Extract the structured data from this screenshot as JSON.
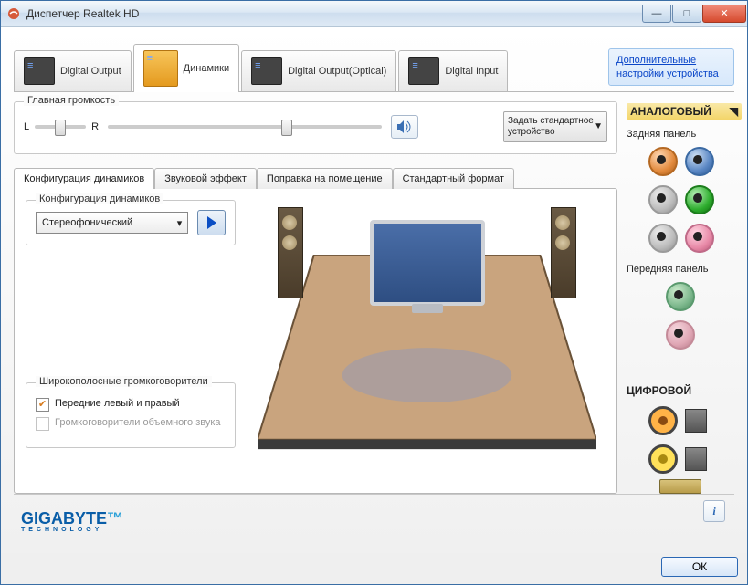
{
  "window": {
    "title": "Диспетчер Realtek HD"
  },
  "topTabs": {
    "t0": "Digital Output",
    "t1": "Динамики",
    "t2": "Digital Output(Optical)",
    "t3": "Digital Input"
  },
  "advancedLink": "Дополнительные настройки устройства",
  "volume": {
    "legend": "Главная громкость",
    "L": "L",
    "R": "R",
    "setDefault": "Задать стандартное устройство"
  },
  "subTabs": {
    "s0": "Конфигурация динамиков",
    "s1": "Звуковой эффект",
    "s2": "Поправка на помещение",
    "s3": "Стандартный формат"
  },
  "config": {
    "legend": "Конфигурация динамиков",
    "dropdown": "Стереофонический"
  },
  "fullrange": {
    "legend": "Широкополосные громкоговорители",
    "opt1": "Передние левый и правый",
    "opt2": "Громкоговорители объемного звука"
  },
  "right": {
    "analog": "АНАЛОГОВЫЙ",
    "back": "Задняя панель",
    "front": "Передняя панель",
    "digital": "ЦИФРОВОЙ"
  },
  "footer": {
    "brand": "GIGABYTE",
    "brandSub": "TECHNOLOGY",
    "ok": "ОК"
  }
}
